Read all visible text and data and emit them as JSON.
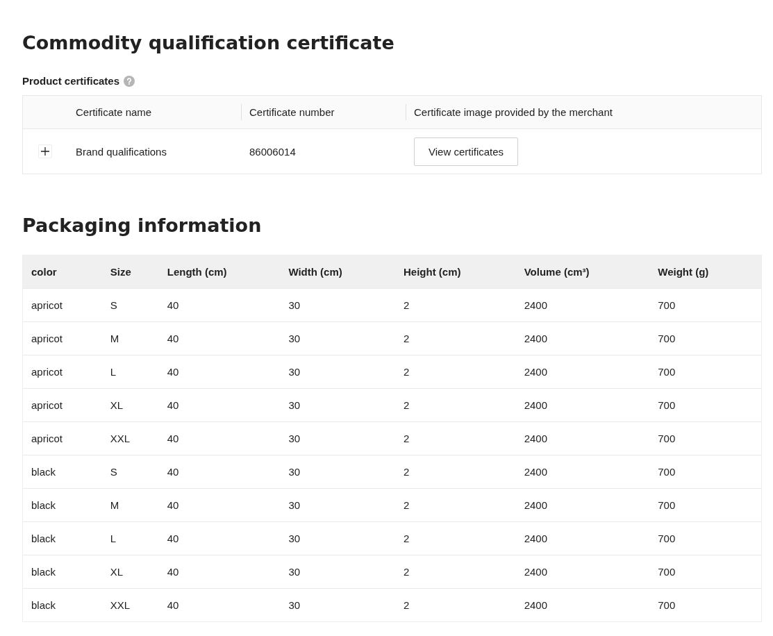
{
  "certificate_section": {
    "title": "Commodity qualification certificate",
    "subtitle": "Product certificates",
    "table": {
      "columns": [
        "Certificate name",
        "Certificate number",
        "Certificate image provided by the merchant"
      ],
      "rows": [
        {
          "expanded": false,
          "name": "Brand qualifications",
          "number": "86006014",
          "button": "View certificates"
        }
      ]
    }
  },
  "packaging_section": {
    "title": "Packaging information",
    "table": {
      "columns": [
        "color",
        "Size",
        "Length (cm)",
        "Width (cm)",
        "Height (cm)",
        "Volume (cm³)",
        "Weight (g)"
      ],
      "rows": [
        [
          "apricot",
          "S",
          "40",
          "30",
          "2",
          "2400",
          "700"
        ],
        [
          "apricot",
          "M",
          "40",
          "30",
          "2",
          "2400",
          "700"
        ],
        [
          "apricot",
          "L",
          "40",
          "30",
          "2",
          "2400",
          "700"
        ],
        [
          "apricot",
          "XL",
          "40",
          "30",
          "2",
          "2400",
          "700"
        ],
        [
          "apricot",
          "XXL",
          "40",
          "30",
          "2",
          "2400",
          "700"
        ],
        [
          "black",
          "S",
          "40",
          "30",
          "2",
          "2400",
          "700"
        ],
        [
          "black",
          "M",
          "40",
          "30",
          "2",
          "2400",
          "700"
        ],
        [
          "black",
          "L",
          "40",
          "30",
          "2",
          "2400",
          "700"
        ],
        [
          "black",
          "XL",
          "40",
          "30",
          "2",
          "2400",
          "700"
        ],
        [
          "black",
          "XXL",
          "40",
          "30",
          "2",
          "2400",
          "700"
        ]
      ]
    }
  }
}
